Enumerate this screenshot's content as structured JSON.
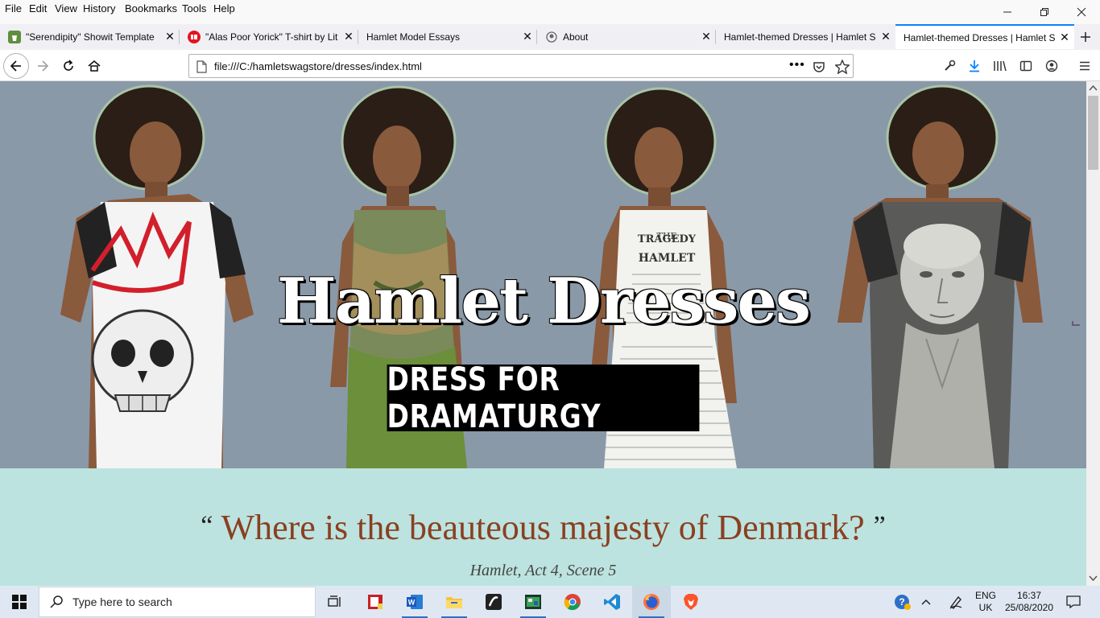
{
  "menubar": {
    "items": [
      {
        "label": "File",
        "key": "F"
      },
      {
        "label": "Edit",
        "key": "E"
      },
      {
        "label": "View",
        "key": "V"
      },
      {
        "label": "History",
        "key": "s"
      },
      {
        "label": "Bookmarks",
        "key": "B"
      },
      {
        "label": "Tools",
        "key": "T"
      },
      {
        "label": "Help",
        "key": "H"
      }
    ]
  },
  "tabs": [
    {
      "title": "\"Serendipity\" Showit Template",
      "icon": "shopify-icon"
    },
    {
      "title": "\"Alas Poor Yorick\" T-shirt by Lit",
      "icon": "redbubble-icon"
    },
    {
      "title": "Hamlet Model Essays",
      "icon": ""
    },
    {
      "title": "About",
      "icon": "github-icon"
    },
    {
      "title": "Hamlet-themed Dresses | Hamlet S",
      "icon": ""
    },
    {
      "title": "Hamlet-themed Dresses | Hamlet S",
      "icon": "",
      "active": true
    }
  ],
  "navbar": {
    "url": "file:///C:/hamletswagstore/dresses/index.html"
  },
  "hero": {
    "title": "Hamlet Dresses",
    "subtitle": "DRESS FOR DRAMATURGY",
    "dress2_text_1": "THE",
    "dress2_text_2": "TRAGEDY",
    "dress2_text_3": "HAMLET"
  },
  "quote": {
    "open": "“",
    "text": "Where is the beauteous majesty of Denmark?",
    "close": "”",
    "attribution": "Hamlet, Act 4, Scene 5"
  },
  "taskbar": {
    "search_placeholder": "Type here to search",
    "lang_top": "ENG",
    "lang_bottom": "UK",
    "time": "16:37",
    "date": "25/08/2020"
  },
  "colors": {
    "hero_bg": "#8a99a8",
    "quote_bg": "#bce3df",
    "quote_text": "#8b3f20",
    "accent": "#0a84ff"
  }
}
